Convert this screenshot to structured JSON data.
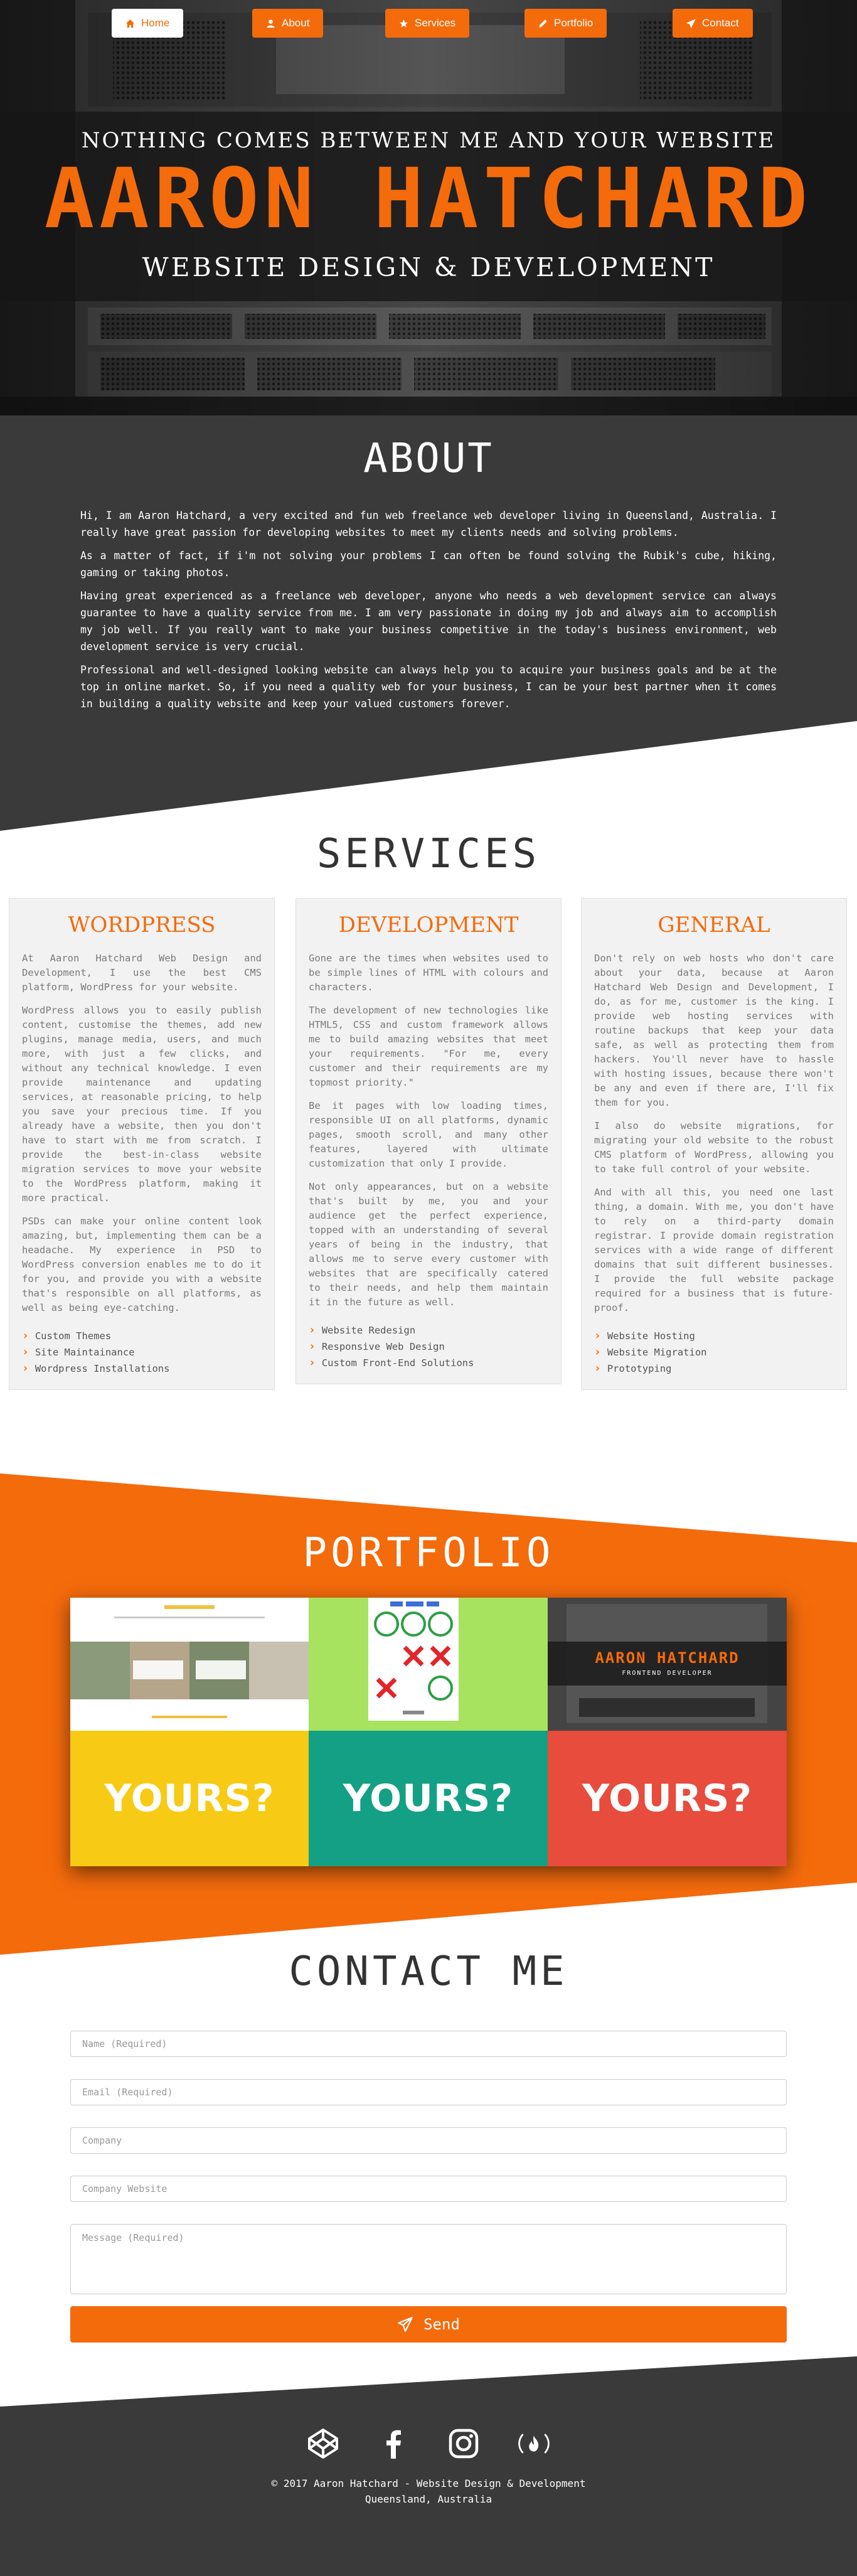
{
  "colors": {
    "accent": "#f46b0c",
    "dark": "#3a3a3a",
    "white": "#ffffff"
  },
  "nav": [
    {
      "label": "Home",
      "icon": "home-icon",
      "active": true
    },
    {
      "label": "About",
      "icon": "user-icon"
    },
    {
      "label": "Services",
      "icon": "star-icon"
    },
    {
      "label": "Portfolio",
      "icon": "pencil-icon"
    },
    {
      "label": "Contact",
      "icon": "paper-plane-icon"
    }
  ],
  "hero": {
    "tagline": "NOTHING COMES BETWEEN ME AND YOUR WEBSITE",
    "name": "AARON HATCHARD",
    "subtitle": "WEBSITE DESIGN & DEVELOPMENT"
  },
  "about": {
    "title": "ABOUT",
    "paragraphs": [
      "Hi, I am Aaron Hatchard, a very excited and fun web freelance web developer living in Queensland, Australia. I really have great passion for developing websites to meet my clients needs and solving problems.",
      "As a matter of fact, if i'm not solving your problems I can often be found solving the Rubik's cube, hiking, gaming or taking photos.",
      "Having great experienced as a freelance web developer, anyone who needs a web development service can always guarantee to have a quality service from me. I am very passionate in doing my job and always aim to accomplish my job well. If you really want to make your business competitive in the today's business environment, web development service is very crucial.",
      "Professional and well-designed looking website can always help you to acquire your business goals and be at the top in online market. So, if you need a quality web for your business, I can be your best partner when it comes in building a quality website and keep your valued customers forever."
    ]
  },
  "services": {
    "title": "SERVICES",
    "cards": [
      {
        "title": "WORDPRESS",
        "paragraphs": [
          "At Aaron Hatchard Web Design and Development, I use the best CMS platform, WordPress for your website.",
          "WordPress allows you to easily publish content, customise the themes, add new plugins, manage media, users, and much more, with just a few clicks, and without any technical knowledge. I even provide maintenance and updating services, at reasonable pricing, to help you save your precious time. If you already have a website, then you don't have to start with me from scratch. I provide the best-in-class website migration services to move your website to the WordPress platform, making it more practical.",
          "PSDs can make your online content look amazing, but, implementing them can be a headache. My experience in PSD to WordPress conversion enables me to do it for you, and provide you with a website that's responsible on all platforms, as well as being eye-catching."
        ],
        "items": [
          "Custom Themes",
          "Site Maintainance",
          "Wordpress Installations"
        ]
      },
      {
        "title": "DEVELOPMENT",
        "paragraphs": [
          "Gone are the times when websites used to be simple lines of HTML with colours and characters.",
          "The development of new technologies like HTML5, CSS and custom framework allows me to build amazing websites that meet your requirements. \"For me, every customer and their requirements are my topmost priority.\"",
          "Be it pages with low loading times, responsible UI on all platforms, dynamic pages, smooth scroll, and many other features, layered with ultimate customization that only I provide.",
          "Not only appearances, but on a website that's built by me, you and your audience get the perfect experience, topped with an understanding of several years of being in the industry, that allows me to serve every customer with websites that are specifically catered to their needs, and help them maintain it in the future as well."
        ],
        "items": [
          "Website Redesign",
          "Responsive Web Design",
          "Custom Front-End Solutions"
        ]
      },
      {
        "title": "GENERAL",
        "paragraphs": [
          "Don't rely on web hosts who don't care about your data, because at Aaron Hatchard Web Design and Development, I do, as for me, customer is the king. I provide web hosting services with routine backups that keep your data safe, as well as protecting them from hackers. You'll never have to hassle with hosting issues, because there won't be any and even if there are, I'll fix them for you.",
          "I also do website migrations, for migrating your old website to the robust CMS platform of WordPress, allowing you to take full control of your website.",
          "And with all this, you need one last thing, a domain. With me, you don't have to rely on a third-party domain registrar. I provide domain registration services with a wide range of different domains that suit different businesses. I provide the full website package required for a business that is future-proof."
        ],
        "items": [
          "Website Hosting",
          "Website Migration",
          "Prototyping"
        ]
      }
    ]
  },
  "portfolio": {
    "title": "PORTFOLIO",
    "thumb3": {
      "name": "AARON HATCHARD",
      "sub": "FRONTEND DEVELOPER"
    },
    "yours": [
      {
        "label": "YOURS?",
        "color": "#f7cb15"
      },
      {
        "label": "YOURS?",
        "color": "#13a085"
      },
      {
        "label": "YOURS?",
        "color": "#e74c3c"
      }
    ]
  },
  "contact": {
    "title": "CONTACT ME",
    "fields": {
      "name": "Name (Required)",
      "email": "Email (Required)",
      "company": "Company",
      "website": "Company Website",
      "message": "Message (Required)"
    },
    "send_label": "Send"
  },
  "footer": {
    "social": [
      "codepen-icon",
      "facebook-icon",
      "instagram-icon",
      "freecodecamp-icon"
    ],
    "copyright": "© 2017 Aaron Hatchard - Website Design & Development",
    "location": "Queensland, Australia"
  }
}
